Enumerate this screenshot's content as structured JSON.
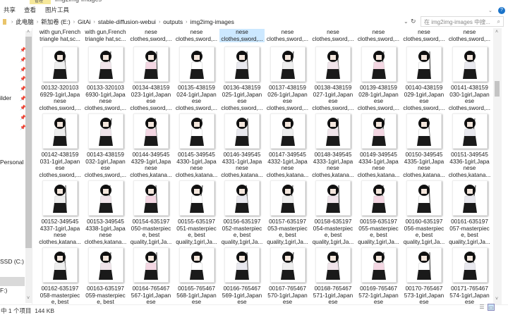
{
  "window": {
    "title": "img2img-images",
    "manage_tab": "管理"
  },
  "ribbon": {
    "tabs": [
      "共享",
      "查看",
      "图片工具"
    ]
  },
  "address": {
    "crumbs": [
      "此电脑",
      "新加卷 (E:)",
      "GitAi",
      "stable-diffusion-webui",
      "outputs",
      "img2img-images"
    ]
  },
  "search": {
    "placeholder": "在 img2img-images 中搜...",
    "icon": "search-icon"
  },
  "sidebar": {
    "items": [
      "ilder",
      "Personal",
      "SSD (C:)",
      "F:)"
    ]
  },
  "status": {
    "selection": "中 1 个项目",
    "size": "144 KB"
  },
  "top_row": [
    [
      "with gun,French",
      "triangle hat,sc..."
    ],
    [
      "with gun,French",
      "triangle hat,sc..."
    ],
    [
      "nese",
      "clothes,sword,..."
    ],
    [
      "nese",
      "clothes,sword,..."
    ],
    [
      "nese",
      "clothes,sword,..."
    ],
    [
      "nese",
      "clothes,sword,..."
    ],
    [
      "nese",
      "clothes,sword,..."
    ],
    [
      "nese",
      "clothes,sword,..."
    ],
    [
      "nese",
      "clothes,sword,..."
    ],
    [
      "nese",
      "clothes,sword,..."
    ]
  ],
  "selected_top_index": 4,
  "rows": [
    [
      [
        "00132-320103",
        "6929-1girl,Japa",
        "nese",
        "clothes,sword,..."
      ],
      [
        "00133-320103",
        "6930-1girl,Japa",
        "nese",
        "clothes,sword,..."
      ],
      [
        "00134-438159",
        "023-1girl,Japan",
        "ese",
        "clothes,sword,..."
      ],
      [
        "00135-438159",
        "024-1girl,Japan",
        "ese",
        "clothes,sword,..."
      ],
      [
        "00136-438159",
        "025-1girl,Japan",
        "ese",
        "clothes,sword,..."
      ],
      [
        "00137-438159",
        "026-1girl,Japan",
        "ese",
        "clothes,sword,..."
      ],
      [
        "00138-438159",
        "027-1girl,Japan",
        "ese",
        "clothes,sword,..."
      ],
      [
        "00139-438159",
        "028-1girl,Japan",
        "ese",
        "clothes,sword,..."
      ],
      [
        "00140-438159",
        "029-1girl,Japan",
        "ese",
        "clothes,sword,..."
      ],
      [
        "00141-438159",
        "030-1girl,Japan",
        "ese",
        "clothes,sword,..."
      ]
    ],
    [
      [
        "00142-438159",
        "031-1girl,Japan",
        "ese",
        "clothes,sword,..."
      ],
      [
        "00143-438159",
        "032-1girl,Japan",
        "ese",
        "clothes,sword,..."
      ],
      [
        "00144-349545",
        "4329-1girl,Japa",
        "nese",
        "clothes,katana..."
      ],
      [
        "00145-349545",
        "4330-1girl,Japa",
        "nese",
        "clothes,katana..."
      ],
      [
        "00146-349545",
        "4331-1girl,Japa",
        "nese",
        "clothes,katana..."
      ],
      [
        "00147-349545",
        "4332-1girl,Japa",
        "nese",
        "clothes,katana..."
      ],
      [
        "00148-349545",
        "4333-1girl,Japa",
        "nese",
        "clothes,katana..."
      ],
      [
        "00149-349545",
        "4334-1girl,Japa",
        "nese",
        "clothes,katana..."
      ],
      [
        "00150-349545",
        "4335-1girl,Japa",
        "nese",
        "clothes,katana..."
      ],
      [
        "00151-349545",
        "4336-1girl,Japa",
        "nese",
        "clothes,katana..."
      ]
    ],
    [
      [
        "00152-349545",
        "4337-1girl,Japa",
        "nese",
        "clothes,katana..."
      ],
      [
        "00153-349545",
        "4338-1girl,Japa",
        "nese",
        "clothes,katana..."
      ],
      [
        "00154-635197",
        "050-masterpiec",
        "e, best",
        "quality,1girl,Ja..."
      ],
      [
        "00155-635197",
        "051-masterpiec",
        "e, best",
        "quality,1girl,Ja..."
      ],
      [
        "00156-635197",
        "052-masterpiec",
        "e, best",
        "quality,1girl,Ja..."
      ],
      [
        "00157-635197",
        "053-masterpiec",
        "e, best",
        "quality,1girl,Ja..."
      ],
      [
        "00158-635197",
        "054-masterpiec",
        "e, best",
        "quality,1girl,Ja..."
      ],
      [
        "00159-635197",
        "055-masterpiec",
        "e, best",
        "quality,1girl,Ja..."
      ],
      [
        "00160-635197",
        "056-masterpiec",
        "e, best",
        "quality,1girl,Ja..."
      ],
      [
        "00161-635197",
        "057-masterpiec",
        "e, best",
        "quality,1girl,Ja..."
      ]
    ],
    [
      [
        "00162-635197",
        "058-masterpiec",
        "e, best"
      ],
      [
        "00163-635197",
        "059-masterpiec",
        "e, best"
      ],
      [
        "00164-765467",
        "567-1girl,Japan",
        "ese"
      ],
      [
        "00165-765467",
        "568-1girl,Japan",
        "ese"
      ],
      [
        "00166-765467",
        "569-1girl,Japan",
        "ese"
      ],
      [
        "00167-765467",
        "570-1girl,Japan",
        "ese"
      ],
      [
        "00168-765467",
        "571-1girl,Japan",
        "ese"
      ],
      [
        "00169-765467",
        "572-1girl,Japan",
        "ese"
      ],
      [
        "00170-765467",
        "573-1girl,Japan",
        "ese"
      ],
      [
        "00171-765467",
        "574-1girl,Japan",
        "ese"
      ]
    ]
  ],
  "colors": {
    "selection": "#cce8ff",
    "manage_tab": "#f6e89a",
    "accent": "#1a73c9"
  }
}
